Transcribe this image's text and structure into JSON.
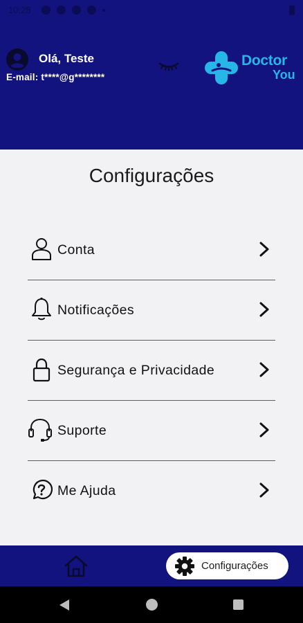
{
  "status_bar": {
    "time": "10:28"
  },
  "header": {
    "greeting": "Olá, Teste",
    "email": "E-mail: t****@g********",
    "logo": {
      "line1": "Doctor",
      "line2": "You"
    }
  },
  "page": {
    "title": "Configurações"
  },
  "menu": {
    "items": [
      {
        "label": "Conta",
        "icon": "user-icon"
      },
      {
        "label": "Notificações",
        "icon": "bell-icon"
      },
      {
        "label": "Segurança e Privacidade",
        "icon": "lock-icon"
      },
      {
        "label": "Suporte",
        "icon": "headset-icon"
      },
      {
        "label": "Me Ajuda",
        "icon": "help-circle-icon"
      }
    ]
  },
  "bottom_nav": {
    "active_label": "Configurações"
  },
  "colors": {
    "primary": "#12137e",
    "accent": "#27b6e8",
    "background": "#f2f2f4"
  }
}
